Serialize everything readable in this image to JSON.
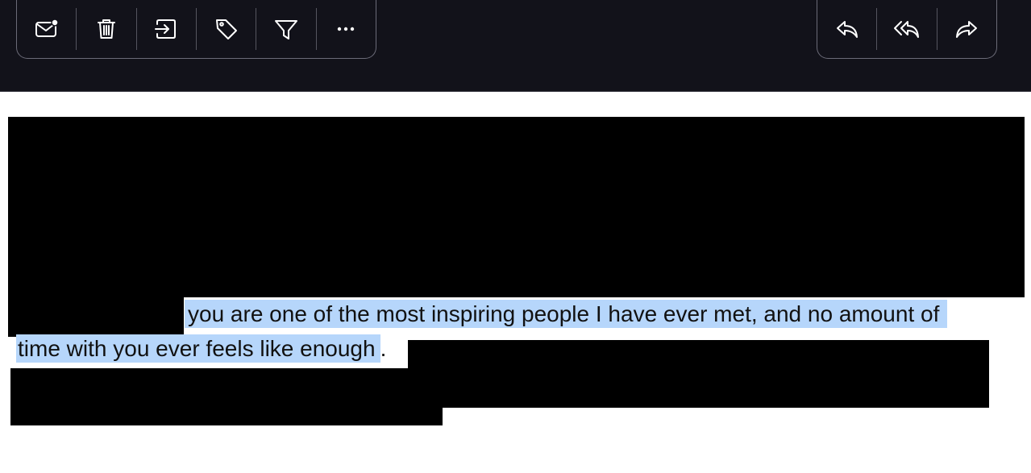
{
  "toolbar": {
    "left_buttons": [
      {
        "name": "mark-unread",
        "icon": "envelope-dot-icon"
      },
      {
        "name": "delete",
        "icon": "trash-icon"
      },
      {
        "name": "move",
        "icon": "move-to-folder-icon"
      },
      {
        "name": "tag",
        "icon": "tag-icon"
      },
      {
        "name": "filter",
        "icon": "filter-icon"
      },
      {
        "name": "more",
        "icon": "more-horizontal-icon"
      }
    ],
    "right_buttons": [
      {
        "name": "reply",
        "icon": "reply-icon"
      },
      {
        "name": "reply-all",
        "icon": "reply-all-icon"
      },
      {
        "name": "forward",
        "icon": "forward-icon"
      }
    ]
  },
  "message": {
    "line1": "you are one of the most inspiring people I have ever met, and no amount of",
    "line2": "time with you ever feels like enough",
    "line2_trailing": "."
  },
  "colors": {
    "toolbar_bg": "#12121a",
    "selection_highlight": "#b6d6fb",
    "redaction": "#000000"
  }
}
